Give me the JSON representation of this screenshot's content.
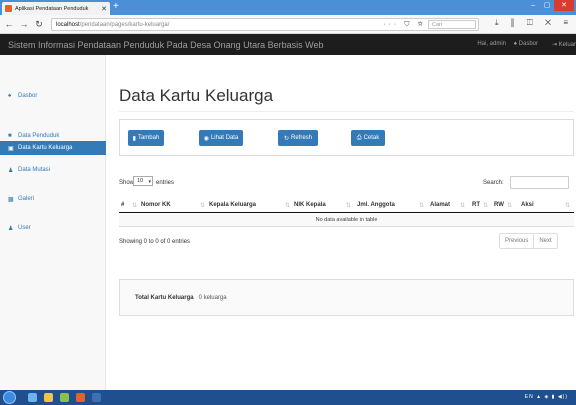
{
  "browser": {
    "tab_title": "Aplikasi Pendataan Penduduk",
    "tab_close": "✕",
    "new_tab": "+",
    "url_host": "localhost",
    "url_path": "/pendataan/pages/kartu-keluarga/",
    "search_placeholder": "Cari",
    "more_actions": "··· ⛉ ☆",
    "right_actions": "⤓ ⫼ ◫ ✕ ≡"
  },
  "app": {
    "title": "Sistem Informasi Pendataan Penduduk Pada Desa Onang Utara Berbasis Web",
    "greeting": "Hai, admin",
    "dashboard_link": "Dasbor",
    "logout_link": "Keluar"
  },
  "sidebar": {
    "items": [
      {
        "label": "Dasbor",
        "icon": "home-icon"
      },
      {
        "label": "Data Penduduk",
        "icon": "book-icon"
      },
      {
        "label": "Data Kartu Keluarga",
        "icon": "card-icon"
      },
      {
        "label": "Data Mutasi",
        "icon": "mutation-icon"
      },
      {
        "label": "Galeri",
        "icon": "image-icon"
      },
      {
        "label": "User",
        "icon": "user-icon"
      }
    ],
    "active_index": 2
  },
  "page": {
    "title": "Data Kartu Keluarga"
  },
  "toolbar": {
    "add_label": "Tambah",
    "view_label": "Lihat Data",
    "refresh_label": "Refresh",
    "print_label": "Cetak"
  },
  "table": {
    "length_label_before": "Show",
    "length_value": "10",
    "length_label_after": "entries",
    "search_label": "Search:",
    "columns": [
      "#",
      "Nomor KK",
      "Kepala Keluarga",
      "NIK Kepala",
      "Jml. Anggota",
      "Alamat",
      "RT",
      "RW",
      "Aksi"
    ],
    "empty_message": "No data available in table",
    "info": "Showing 0 to 0 of 0 entries",
    "prev_label": "Previous",
    "next_label": "Next"
  },
  "summary": {
    "label": "Total Kartu Keluarga",
    "value": "0 keluarga"
  },
  "colors": {
    "primary": "#337ab7",
    "header_bg": "#1d1d1d",
    "browser_accent": "#4a8fd8"
  }
}
